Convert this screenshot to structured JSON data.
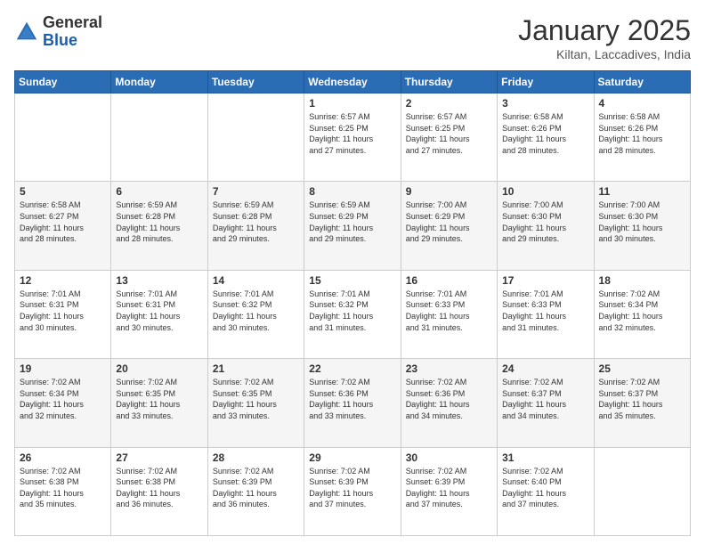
{
  "logo": {
    "general": "General",
    "blue": "Blue"
  },
  "header": {
    "month": "January 2025",
    "location": "Kiltan, Laccadives, India"
  },
  "days": [
    "Sunday",
    "Monday",
    "Tuesday",
    "Wednesday",
    "Thursday",
    "Friday",
    "Saturday"
  ],
  "weeks": [
    [
      {
        "day": "",
        "info": ""
      },
      {
        "day": "",
        "info": ""
      },
      {
        "day": "",
        "info": ""
      },
      {
        "day": "1",
        "info": "Sunrise: 6:57 AM\nSunset: 6:25 PM\nDaylight: 11 hours\nand 27 minutes."
      },
      {
        "day": "2",
        "info": "Sunrise: 6:57 AM\nSunset: 6:25 PM\nDaylight: 11 hours\nand 27 minutes."
      },
      {
        "day": "3",
        "info": "Sunrise: 6:58 AM\nSunset: 6:26 PM\nDaylight: 11 hours\nand 28 minutes."
      },
      {
        "day": "4",
        "info": "Sunrise: 6:58 AM\nSunset: 6:26 PM\nDaylight: 11 hours\nand 28 minutes."
      }
    ],
    [
      {
        "day": "5",
        "info": "Sunrise: 6:58 AM\nSunset: 6:27 PM\nDaylight: 11 hours\nand 28 minutes."
      },
      {
        "day": "6",
        "info": "Sunrise: 6:59 AM\nSunset: 6:28 PM\nDaylight: 11 hours\nand 28 minutes."
      },
      {
        "day": "7",
        "info": "Sunrise: 6:59 AM\nSunset: 6:28 PM\nDaylight: 11 hours\nand 29 minutes."
      },
      {
        "day": "8",
        "info": "Sunrise: 6:59 AM\nSunset: 6:29 PM\nDaylight: 11 hours\nand 29 minutes."
      },
      {
        "day": "9",
        "info": "Sunrise: 7:00 AM\nSunset: 6:29 PM\nDaylight: 11 hours\nand 29 minutes."
      },
      {
        "day": "10",
        "info": "Sunrise: 7:00 AM\nSunset: 6:30 PM\nDaylight: 11 hours\nand 29 minutes."
      },
      {
        "day": "11",
        "info": "Sunrise: 7:00 AM\nSunset: 6:30 PM\nDaylight: 11 hours\nand 30 minutes."
      }
    ],
    [
      {
        "day": "12",
        "info": "Sunrise: 7:01 AM\nSunset: 6:31 PM\nDaylight: 11 hours\nand 30 minutes."
      },
      {
        "day": "13",
        "info": "Sunrise: 7:01 AM\nSunset: 6:31 PM\nDaylight: 11 hours\nand 30 minutes."
      },
      {
        "day": "14",
        "info": "Sunrise: 7:01 AM\nSunset: 6:32 PM\nDaylight: 11 hours\nand 30 minutes."
      },
      {
        "day": "15",
        "info": "Sunrise: 7:01 AM\nSunset: 6:32 PM\nDaylight: 11 hours\nand 31 minutes."
      },
      {
        "day": "16",
        "info": "Sunrise: 7:01 AM\nSunset: 6:33 PM\nDaylight: 11 hours\nand 31 minutes."
      },
      {
        "day": "17",
        "info": "Sunrise: 7:01 AM\nSunset: 6:33 PM\nDaylight: 11 hours\nand 31 minutes."
      },
      {
        "day": "18",
        "info": "Sunrise: 7:02 AM\nSunset: 6:34 PM\nDaylight: 11 hours\nand 32 minutes."
      }
    ],
    [
      {
        "day": "19",
        "info": "Sunrise: 7:02 AM\nSunset: 6:34 PM\nDaylight: 11 hours\nand 32 minutes."
      },
      {
        "day": "20",
        "info": "Sunrise: 7:02 AM\nSunset: 6:35 PM\nDaylight: 11 hours\nand 33 minutes."
      },
      {
        "day": "21",
        "info": "Sunrise: 7:02 AM\nSunset: 6:35 PM\nDaylight: 11 hours\nand 33 minutes."
      },
      {
        "day": "22",
        "info": "Sunrise: 7:02 AM\nSunset: 6:36 PM\nDaylight: 11 hours\nand 33 minutes."
      },
      {
        "day": "23",
        "info": "Sunrise: 7:02 AM\nSunset: 6:36 PM\nDaylight: 11 hours\nand 34 minutes."
      },
      {
        "day": "24",
        "info": "Sunrise: 7:02 AM\nSunset: 6:37 PM\nDaylight: 11 hours\nand 34 minutes."
      },
      {
        "day": "25",
        "info": "Sunrise: 7:02 AM\nSunset: 6:37 PM\nDaylight: 11 hours\nand 35 minutes."
      }
    ],
    [
      {
        "day": "26",
        "info": "Sunrise: 7:02 AM\nSunset: 6:38 PM\nDaylight: 11 hours\nand 35 minutes."
      },
      {
        "day": "27",
        "info": "Sunrise: 7:02 AM\nSunset: 6:38 PM\nDaylight: 11 hours\nand 36 minutes."
      },
      {
        "day": "28",
        "info": "Sunrise: 7:02 AM\nSunset: 6:39 PM\nDaylight: 11 hours\nand 36 minutes."
      },
      {
        "day": "29",
        "info": "Sunrise: 7:02 AM\nSunset: 6:39 PM\nDaylight: 11 hours\nand 37 minutes."
      },
      {
        "day": "30",
        "info": "Sunrise: 7:02 AM\nSunset: 6:39 PM\nDaylight: 11 hours\nand 37 minutes."
      },
      {
        "day": "31",
        "info": "Sunrise: 7:02 AM\nSunset: 6:40 PM\nDaylight: 11 hours\nand 37 minutes."
      },
      {
        "day": "",
        "info": ""
      }
    ]
  ]
}
